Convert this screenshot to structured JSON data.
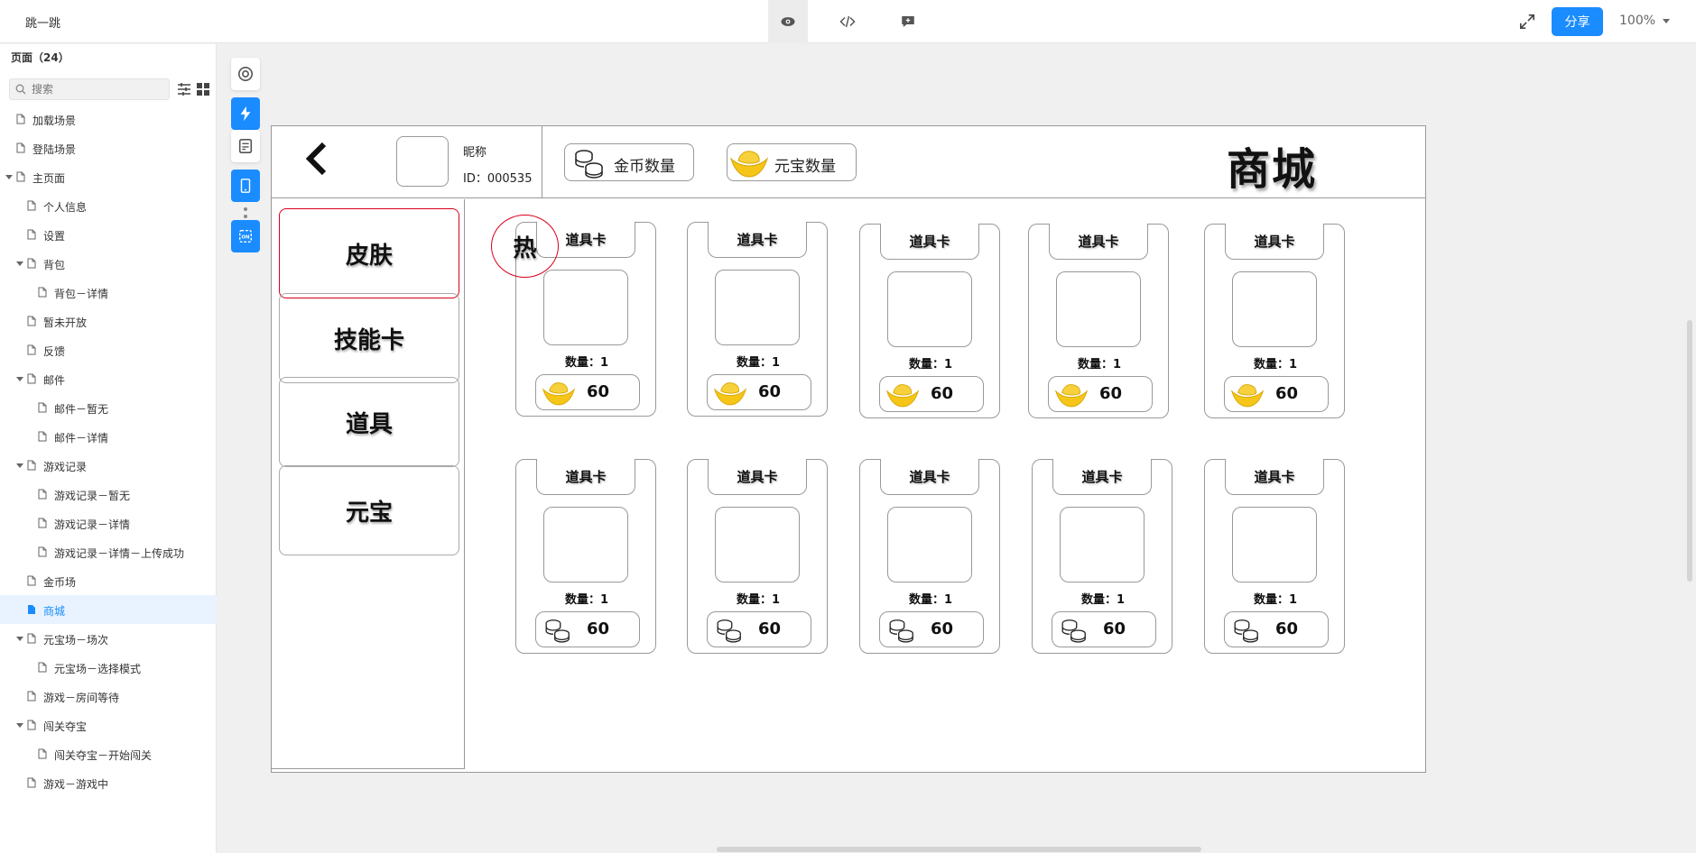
{
  "app": {
    "title": "跳一跳"
  },
  "topbar": {
    "share_label": "分享",
    "zoom": "100%"
  },
  "sidebar": {
    "header": "页面（24）",
    "search_placeholder": "搜索",
    "pages": [
      {
        "label": "加载场景",
        "depth": 0,
        "expandable": false
      },
      {
        "label": "登陆场景",
        "depth": 0,
        "expandable": false
      },
      {
        "label": "主页面",
        "depth": 0,
        "expandable": true
      },
      {
        "label": "个人信息",
        "depth": 1,
        "expandable": false
      },
      {
        "label": "设置",
        "depth": 1,
        "expandable": false
      },
      {
        "label": "背包",
        "depth": 1,
        "expandable": true
      },
      {
        "label": "背包－详情",
        "depth": 2,
        "expandable": false
      },
      {
        "label": "暂未开放",
        "depth": 1,
        "expandable": false
      },
      {
        "label": "反馈",
        "depth": 1,
        "expandable": false
      },
      {
        "label": "邮件",
        "depth": 1,
        "expandable": true
      },
      {
        "label": "邮件－暂无",
        "depth": 2,
        "expandable": false
      },
      {
        "label": "邮件－详情",
        "depth": 2,
        "expandable": false
      },
      {
        "label": "游戏记录",
        "depth": 1,
        "expandable": true
      },
      {
        "label": "游戏记录－暂无",
        "depth": 2,
        "expandable": false
      },
      {
        "label": "游戏记录－详情",
        "depth": 2,
        "expandable": false
      },
      {
        "label": "游戏记录－详情－上传成功",
        "depth": 2,
        "expandable": false
      },
      {
        "label": "金币场",
        "depth": 1,
        "expandable": false
      },
      {
        "label": "商城",
        "depth": 1,
        "expandable": false,
        "selected": true
      },
      {
        "label": "元宝场－场次",
        "depth": 1,
        "expandable": true
      },
      {
        "label": "元宝场－选择模式",
        "depth": 2,
        "expandable": false
      },
      {
        "label": "游戏－房间等待",
        "depth": 1,
        "expandable": false
      },
      {
        "label": "闯关夺宝",
        "depth": 1,
        "expandable": true
      },
      {
        "label": "闯关夺宝－开始闯关",
        "depth": 2,
        "expandable": false
      },
      {
        "label": "游戏－游戏中",
        "depth": 1,
        "expandable": false
      }
    ]
  },
  "artboard": {
    "profile": {
      "nickname": "昵称",
      "id": "ID：000535"
    },
    "gold_label": "金币数量",
    "ingot_label": "元宝数量",
    "shop_title": "商城",
    "categories": [
      "皮肤",
      "技能卡",
      "道具",
      "元宝"
    ],
    "active_category": 0,
    "hot_badge": "热",
    "cards": [
      {
        "title": "道具卡",
        "qty": "数量：1",
        "price": "60",
        "currency": "ingot-icon"
      },
      {
        "title": "道具卡",
        "qty": "数量：1",
        "price": "60",
        "currency": "ingot-icon"
      },
      {
        "title": "道具卡",
        "qty": "数量：1",
        "price": "60",
        "currency": "ingot-icon"
      },
      {
        "title": "道具卡",
        "qty": "数量：1",
        "price": "60",
        "currency": "ingot-icon"
      },
      {
        "title": "道具卡",
        "qty": "数量：1",
        "price": "60",
        "currency": "ingot-icon"
      },
      {
        "title": "道具卡",
        "qty": "数量：1",
        "price": "60",
        "currency": "coin-stack-icon"
      },
      {
        "title": "道具卡",
        "qty": "数量：1",
        "price": "60",
        "currency": "coin-stack-icon"
      },
      {
        "title": "道具卡",
        "qty": "数量：1",
        "price": "60",
        "currency": "coin-stack-icon"
      },
      {
        "title": "道具卡",
        "qty": "数量：1",
        "price": "60",
        "currency": "coin-stack-icon"
      },
      {
        "title": "道具卡",
        "qty": "数量：1",
        "price": "60",
        "currency": "coin-stack-icon"
      }
    ]
  },
  "colors": {
    "accent": "#1a8cff",
    "selected_border": "#d9001b",
    "ingot": "#f5c518"
  }
}
